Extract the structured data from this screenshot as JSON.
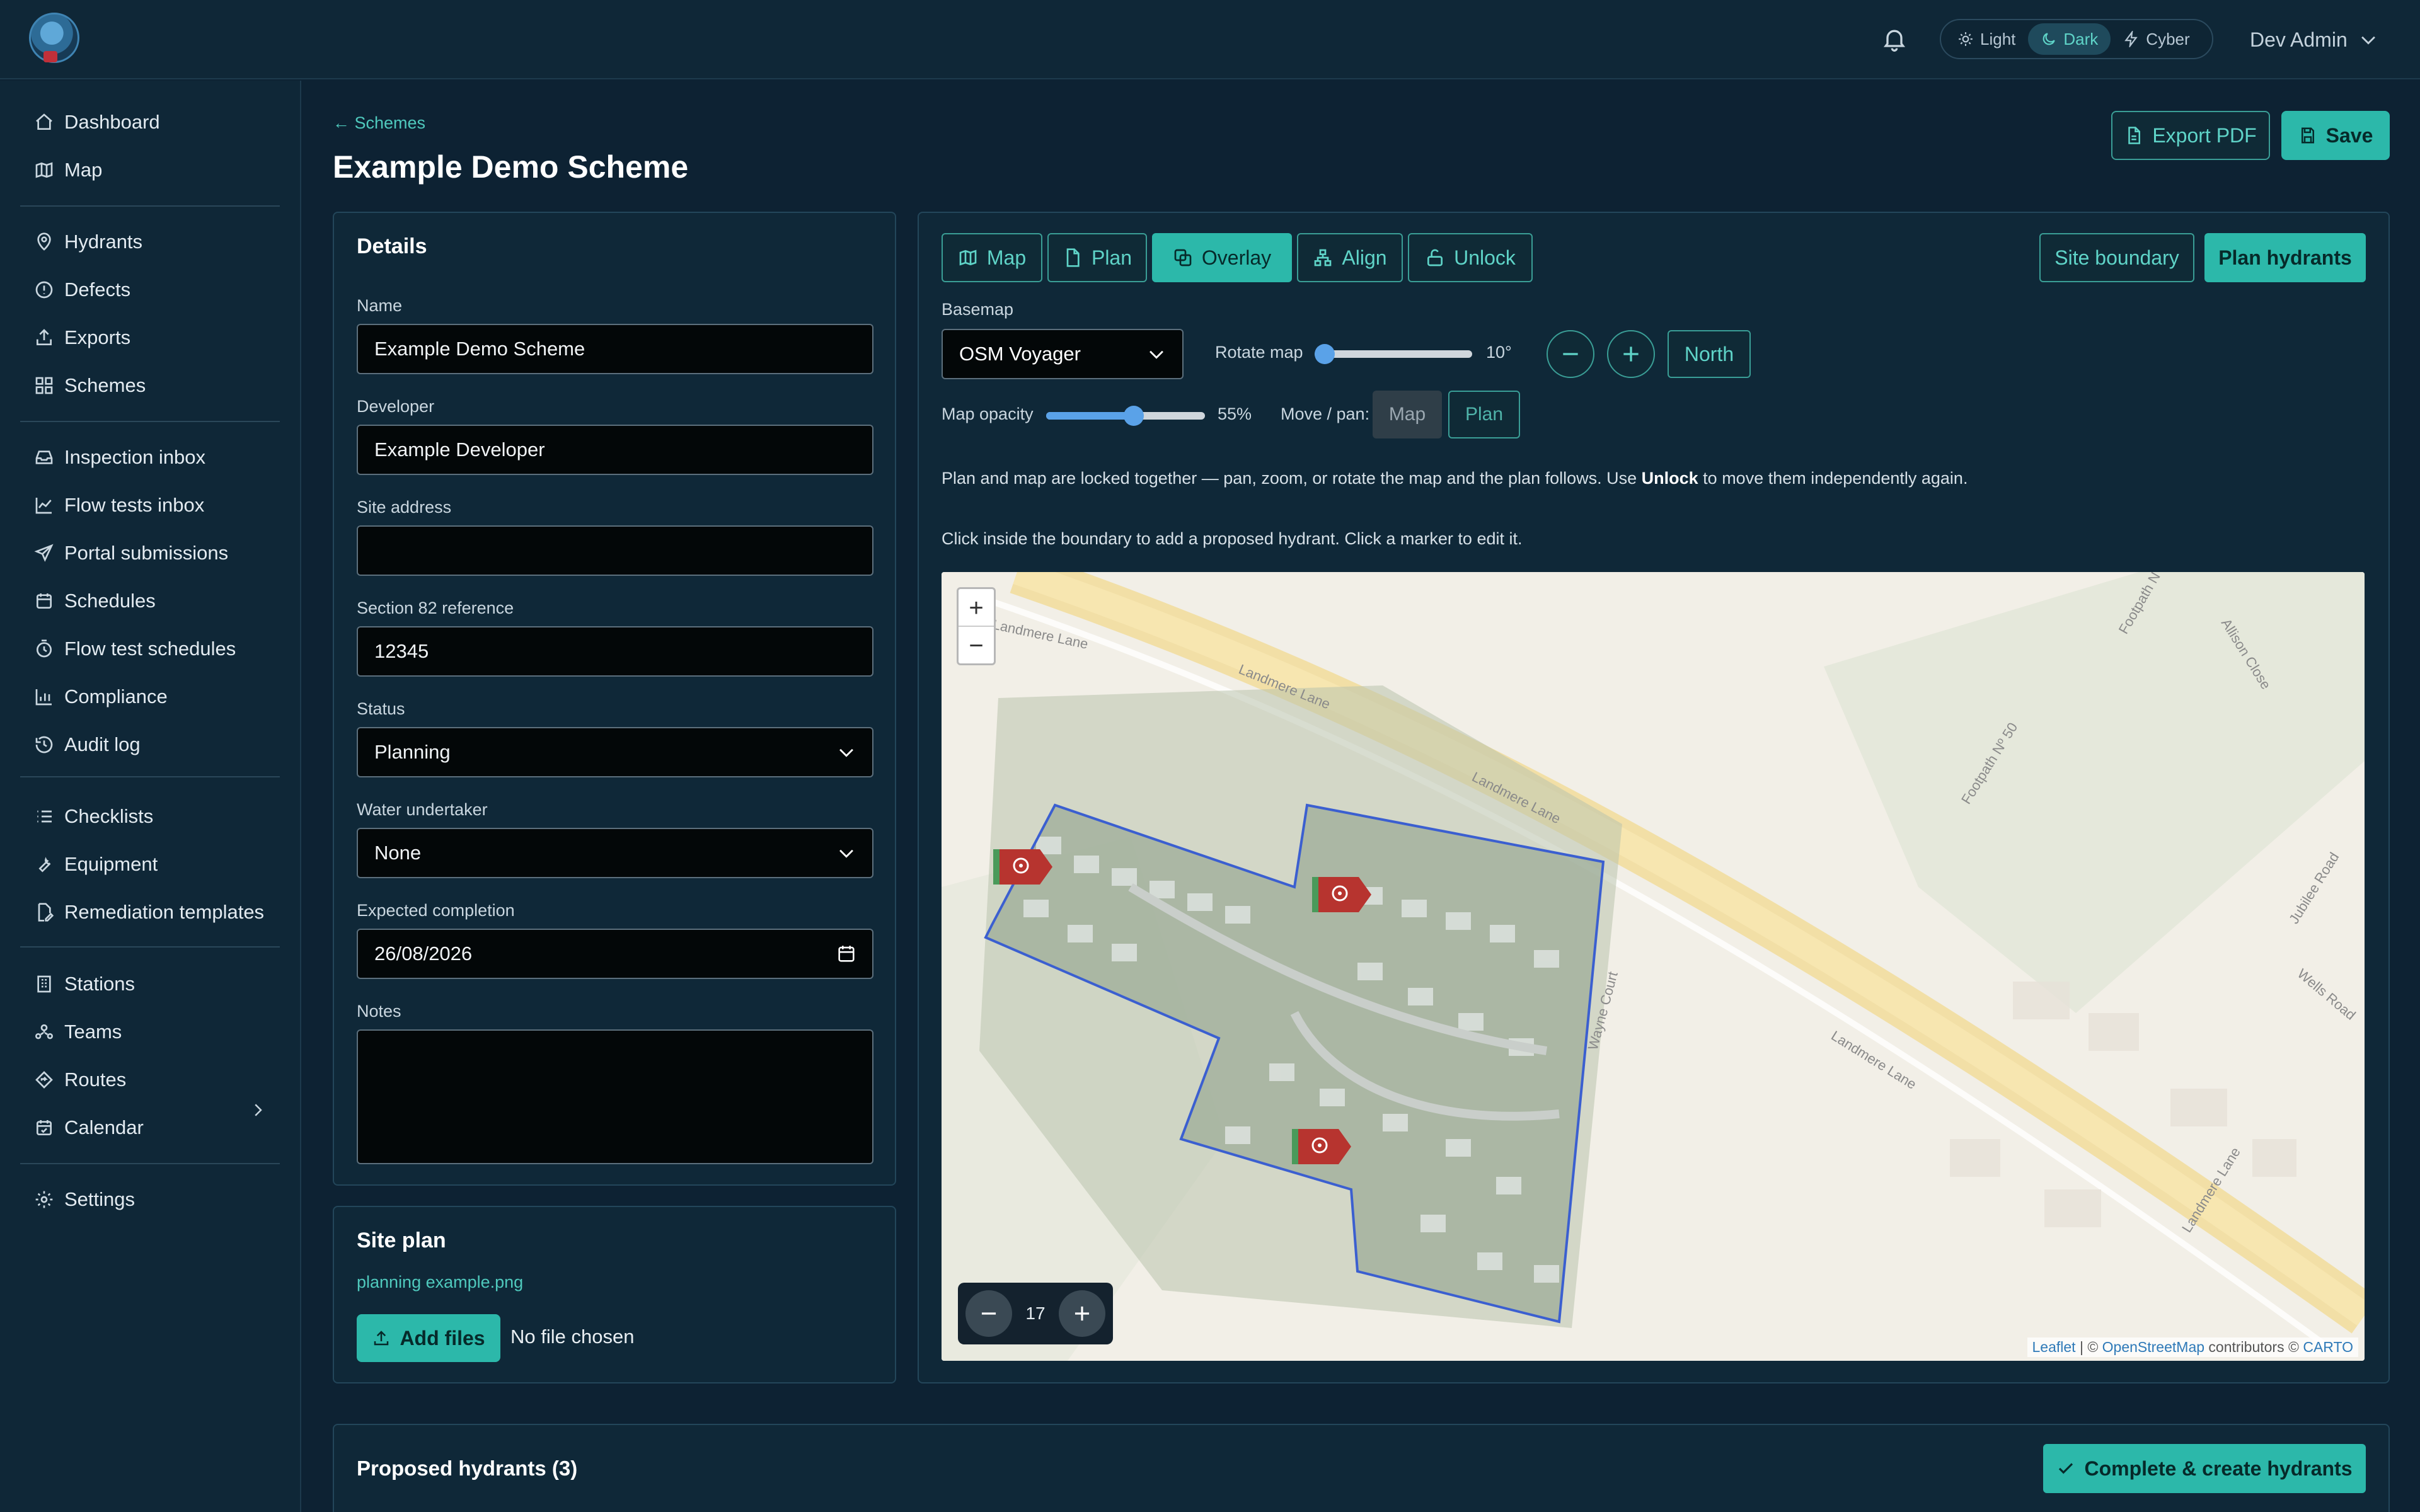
{
  "header": {
    "theme_options": [
      "Light",
      "Dark",
      "Cyber"
    ],
    "active_theme": "Dark",
    "user_name": "Dev Admin"
  },
  "sidebar": {
    "items": [
      {
        "label": "Dashboard",
        "icon": "home-icon"
      },
      {
        "label": "Map",
        "icon": "map-icon"
      },
      {
        "label": "Hydrants",
        "icon": "pin-icon"
      },
      {
        "label": "Defects",
        "icon": "alert-icon"
      },
      {
        "label": "Exports",
        "icon": "export-icon"
      },
      {
        "label": "Schemes",
        "icon": "grid-icon"
      },
      {
        "label": "Inspection inbox",
        "icon": "inbox-icon"
      },
      {
        "label": "Flow tests inbox",
        "icon": "chart-line-icon"
      },
      {
        "label": "Portal submissions",
        "icon": "send-icon"
      },
      {
        "label": "Schedules",
        "icon": "calendar-icon"
      },
      {
        "label": "Flow test schedules",
        "icon": "timer-icon"
      },
      {
        "label": "Compliance",
        "icon": "bar-chart-icon"
      },
      {
        "label": "Audit log",
        "icon": "history-icon"
      },
      {
        "label": "Checklists",
        "icon": "list-icon"
      },
      {
        "label": "Equipment",
        "icon": "wrench-icon"
      },
      {
        "label": "Remediation templates",
        "icon": "file-edit-icon"
      },
      {
        "label": "Stations",
        "icon": "building-icon"
      },
      {
        "label": "Teams",
        "icon": "team-icon"
      },
      {
        "label": "Routes",
        "icon": "route-icon"
      },
      {
        "label": "Calendar",
        "icon": "calendar-check-icon"
      },
      {
        "label": "Settings",
        "icon": "gear-icon"
      }
    ]
  },
  "page": {
    "back_label": "← Schemes",
    "title": "Example Demo Scheme",
    "export_label": "Export PDF",
    "save_label": "Save"
  },
  "details": {
    "title": "Details",
    "name_label": "Name",
    "name_value": "Example Demo Scheme",
    "developer_label": "Developer",
    "developer_value": "Example Developer",
    "site_address_label": "Site address",
    "site_address_value": "",
    "section82_label": "Section 82 reference",
    "section82_value": "12345",
    "status_label": "Status",
    "status_value": "Planning",
    "water_label": "Water undertaker",
    "water_value": "None",
    "completion_label": "Expected completion",
    "completion_value": "26/08/2026",
    "notes_label": "Notes",
    "notes_value": ""
  },
  "site_plan": {
    "title": "Site plan",
    "file_link": "planning example.png",
    "add_files_label": "Add files",
    "no_file_label": "No file chosen"
  },
  "map_panel": {
    "tabs": [
      "Map",
      "Plan",
      "Overlay",
      "Align",
      "Unlock"
    ],
    "active_tab": "Overlay",
    "site_boundary_label": "Site boundary",
    "plan_hydrants_label": "Plan hydrants",
    "basemap_label": "Basemap",
    "basemap_value": "OSM Voyager",
    "rotate_label": "Rotate map",
    "rotate_value": "10°",
    "rotate_fraction": 0.0,
    "north_label": "North",
    "opacity_label": "Map opacity",
    "opacity_value": "55%",
    "opacity_fraction": 0.55,
    "pan_label": "Move / pan:",
    "pan_map_label": "Map",
    "pan_plan_label": "Plan",
    "info_locked_pre": "Plan and map are locked together — pan, zoom, or rotate the map and the plan follows. Use ",
    "info_locked_bold": "Unlock",
    "info_locked_post": " to move them independently again.",
    "info_click": "Click inside the boundary to add a proposed hydrant. Click a marker to edit it.",
    "zoom_level": "17",
    "street_labels": [
      "Landmere Lane",
      "Landmere Lane",
      "Landmere Lane",
      "Landmere Lane",
      "Landmere Lane",
      "Footpath Nº 50",
      "Allison Close",
      "Jubilee Road",
      "Wells Road",
      "Wayne Court",
      "Footpath N"
    ],
    "attribution_leaflet": "Leaflet",
    "attribution_sep": " | © ",
    "attribution_osm": "OpenStreetMap",
    "attribution_mid": " contributors © ",
    "attribution_carto": "CARTO"
  },
  "hydrants": {
    "title": "Proposed hydrants (3)",
    "complete_label": "Complete & create hydrants"
  },
  "colors": {
    "accent": "#2cb8aa",
    "background": "#0d2233",
    "panel": "#0f2838",
    "marker": "#b7342f"
  }
}
